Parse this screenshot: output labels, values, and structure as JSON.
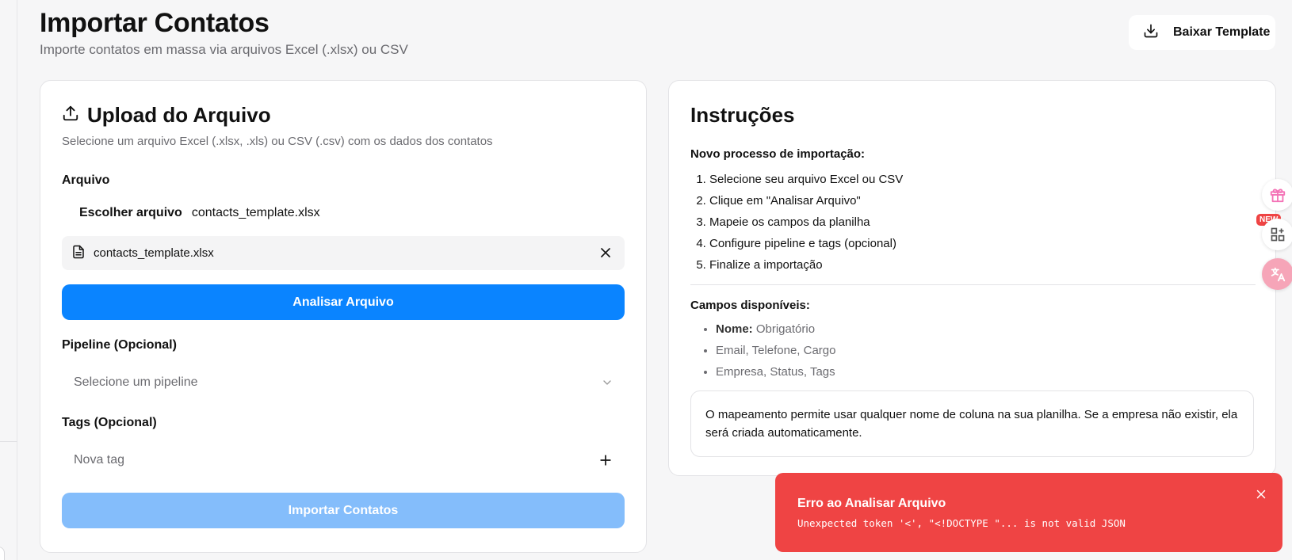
{
  "header": {
    "title": "Importar Contatos",
    "subtitle": "Importe contatos em massa via arquivos Excel (.xlsx) ou CSV",
    "template_button": "Baixar Template"
  },
  "upload": {
    "title": "Upload do Arquivo",
    "description": "Selecione um arquivo Excel (.xlsx, .xls) ou CSV (.csv) com os dados dos contatos",
    "file_label": "Arquivo",
    "choose_label": "Escolher arquivo",
    "chosen_file": "contacts_template.xlsx",
    "chip_file": "contacts_template.xlsx",
    "analyze_button": "Analisar Arquivo",
    "pipeline_label": "Pipeline (Opcional)",
    "pipeline_placeholder": "Selecione um pipeline",
    "tags_label": "Tags (Opcional)",
    "tag_placeholder": "Nova tag",
    "import_button": "Importar Contatos"
  },
  "instructions": {
    "title": "Instruções",
    "process_heading": "Novo processo de importação:",
    "steps": [
      "Selecione seu arquivo Excel ou CSV",
      "Clique em \"Analisar Arquivo\"",
      "Mapeie os campos da planilha",
      "Configure pipeline e tags (opcional)",
      "Finalize a importação"
    ],
    "fields_heading": "Campos disponíveis:",
    "required_label": "Nome:",
    "required_value": "Obrigatório",
    "fields": [
      "Email, Telefone, Cargo",
      "Empresa, Status, Tags"
    ],
    "note": "O mapeamento permite usar qualquer nome de coluna na sua planilha. Se a empresa não existir, ela será criada automaticamente."
  },
  "side": {
    "new_badge": "NEW"
  },
  "toast": {
    "title": "Erro ao Analisar Arquivo",
    "message": "Unexpected token '<', \"<!DOCTYPE \"... is not valid JSON"
  },
  "colors": {
    "primary": "#0a84ff",
    "primary_disabled": "#84bdfb",
    "error": "#ef4444"
  }
}
